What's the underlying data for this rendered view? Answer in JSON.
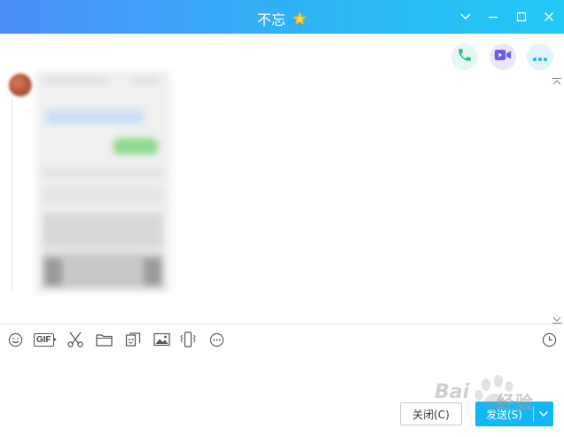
{
  "window": {
    "title": "不忘",
    "accent": "#12b7f5",
    "titlebar_gradient_start": "#4c8ef5",
    "titlebar_gradient_end": "#22c9f6",
    "vip_badge_icon": "gold-star-badge-icon",
    "controls": [
      "chevron-down-icon",
      "minimize-icon",
      "maximize-icon",
      "close-icon"
    ]
  },
  "header_actions": [
    {
      "name": "voice-call-button",
      "icon": "phone-icon",
      "bg": "#e5f7f0",
      "color": "#26c281"
    },
    {
      "name": "video-call-button",
      "icon": "video-icon",
      "bg": "#ece8fb",
      "color": "#6a5cf0"
    },
    {
      "name": "more-options-button",
      "icon": "more-icon",
      "bg": "#e3f3fd",
      "color": "#12b7f5"
    }
  ],
  "message": {
    "type": "image",
    "content": "blurred-screenshot-image"
  },
  "toolbar": {
    "gif_label": "GIF",
    "icons": [
      "emoji-icon",
      "gif-icon",
      "screenshot-scissors-icon",
      "folder-icon",
      "sticker-icon",
      "image-icon",
      "shake-icon",
      "more-circle-icon",
      "history-clock-icon"
    ]
  },
  "input": {
    "value": ""
  },
  "actions": {
    "close_label": "关闭(C)",
    "send_label": "发送(S)"
  },
  "watermark": {
    "text": "经验",
    "brand": "Bai"
  }
}
